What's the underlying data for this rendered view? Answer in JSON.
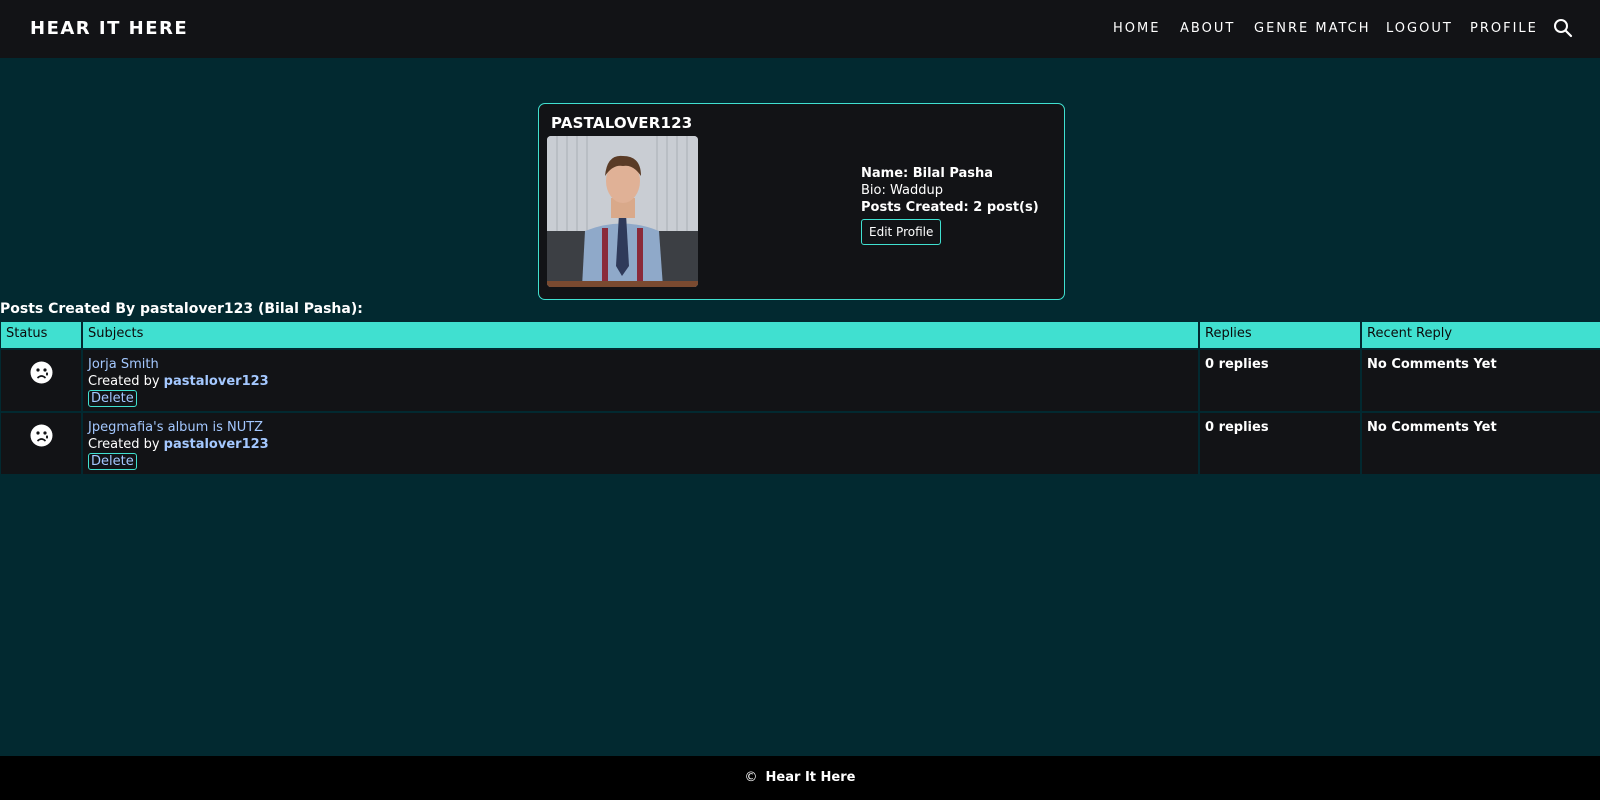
{
  "nav": {
    "brand": "HEAR IT HERE",
    "links": [
      "HOME",
      "ABOUT",
      "GENRE MATCH",
      "LOGOUT",
      "PROFILE"
    ],
    "search_icon": "search-icon"
  },
  "profile": {
    "username": "PASTALOVER123",
    "name_label": "Name: Bilal Pasha",
    "bio_label": "Bio: Waddup",
    "posts_label": "Posts Created: 2 post(s)",
    "edit_label": "Edit Profile"
  },
  "posts_heading": "Posts Created By pastalover123 (Bilal Pasha):",
  "table": {
    "headers": [
      "Status",
      "Subjects",
      "Replies",
      "Recent Reply"
    ],
    "rows": [
      {
        "status_icon": "sad-face-icon",
        "subject": "Jorja Smith",
        "created_by": "Created by",
        "author": "pastalover123",
        "delete_label": "Delete",
        "replies": "0 replies",
        "recent": "No Comments Yet"
      },
      {
        "status_icon": "sad-face-icon",
        "subject": "Jpegmafia's album is NUTZ",
        "created_by": "Created by",
        "author": "pastalover123",
        "delete_label": "Delete",
        "replies": "0 replies",
        "recent": "No Comments Yet"
      }
    ]
  },
  "footer": {
    "copyright": "©",
    "text": "Hear It Here"
  },
  "colors": {
    "background": "#022930",
    "panel": "#121316",
    "accent": "#40e0d0",
    "link": "#a4c8ff"
  }
}
